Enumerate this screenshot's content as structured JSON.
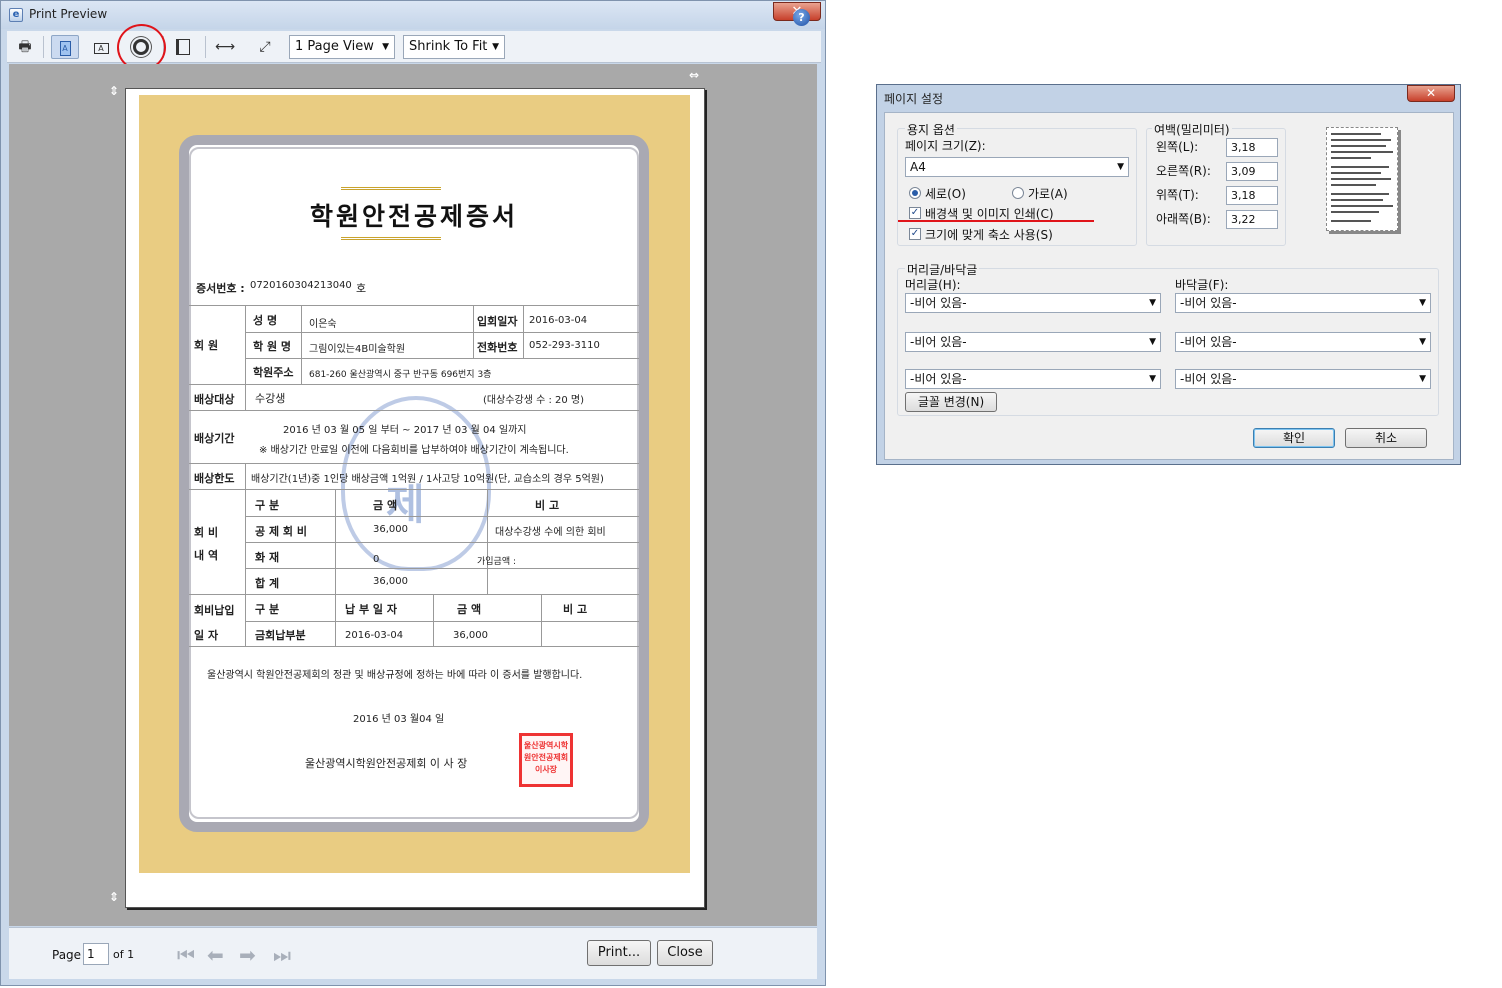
{
  "window": {
    "title": "Print Preview",
    "close": "✕"
  },
  "toolbar": {
    "page_view": "1 Page View",
    "shrink": "Shrink To Fit",
    "help": "?"
  },
  "certificate": {
    "title": "학원안전공제증서",
    "cert_no_label": "증서번호 :",
    "cert_no": "0720160304213040",
    "cert_no_suffix": "호",
    "member_label": "회  원",
    "name_label": "성  명",
    "name": "이은숙",
    "join_label": "입회일자",
    "join_date": "2016-03-04",
    "academy_label": "학 원 명",
    "academy": "그림이있는4B미술학원",
    "phone_label": "전화번호",
    "phone": "052-293-3110",
    "address_label": "학원주소",
    "address": "681-260 울산광역시 중구 반구동 696번지 3층",
    "target_label": "배상대상",
    "target": "수강생",
    "target_count": "(대상수강생 수 : 20  명)",
    "period_label": "배상기간",
    "period": "2016  년 03  월 05  일 부터 ~  2017  년 03  월 04  일까지",
    "period_note": "※ 배상기간 만료일 이전에 다음회비를 납부하여야 배상기간이 계속됩니다.",
    "limit_label": "배상한도",
    "limit": "배상기간(1년)중 1인당 배상금액 1억원 / 1사고당 10억원(단, 교습소의 경우 5억원)",
    "fee_label_1": "회  비",
    "fee_label_2": "내  역",
    "col_div": "구      분",
    "col_amt": "금      액",
    "col_note": "비      고",
    "row1": "공 제 회 비",
    "row1_amt": "36,000",
    "row1_note": "대상수강생 수에 의한 회비",
    "row2": "화      재",
    "row2_amt": "0",
    "row2_note": "가입금액 :",
    "row3": "합      계",
    "row3_amt": "36,000",
    "pay_label_1": "회비납입",
    "pay_label_2": "일    자",
    "pay_div": "구      분",
    "pay_date_h": "납 부 일 자",
    "pay_amt_h": "금      액",
    "pay_note_h": "비      고",
    "pay_row": "금회납부분",
    "pay_date": "2016-03-04",
    "pay_amt": "36,000",
    "statement": "울산광역시 학원안전공제회의 정관 및 배상규정에 정하는 바에 따라 이 증서를 발행합니다.",
    "issue_date": "2016  년 03  월04  일",
    "issuer": "울산광역시학원안전공제회  이   사   장",
    "seal_char": "제",
    "stamp": "울산광역시학원안전공제회이사장"
  },
  "bottom": {
    "page_label": "Page",
    "page": "1",
    "of": "of 1",
    "print": "Print...",
    "close": "Close"
  },
  "dialog": {
    "title": "페이지 설정",
    "close": "✕",
    "paper_group": "용지 옵션",
    "paper_size_label": "페이지 크기(Z):",
    "paper_size": "A4",
    "portrait": "세로(O)",
    "landscape": "가로(A)",
    "print_bg": "배경색 및 이미지 인쇄(C)",
    "shrink": "크기에 맞게 축소 사용(S)",
    "margin_group": "여백(밀리미터)",
    "left_label": "왼쪽(L):",
    "left": "3,18",
    "right_label": "오른쪽(R):",
    "right": "3,09",
    "top_label": "위쪽(T):",
    "top": "3,18",
    "bottom_label": "아래쪽(B):",
    "bottom": "3,22",
    "hf_group": "머리글/바닥글",
    "header_label": "머리글(H):",
    "footer_label": "바닥글(F):",
    "empty": "-비어 있음-",
    "font_btn": "글꼴 변경(N)",
    "ok": "확인",
    "cancel": "취소"
  }
}
